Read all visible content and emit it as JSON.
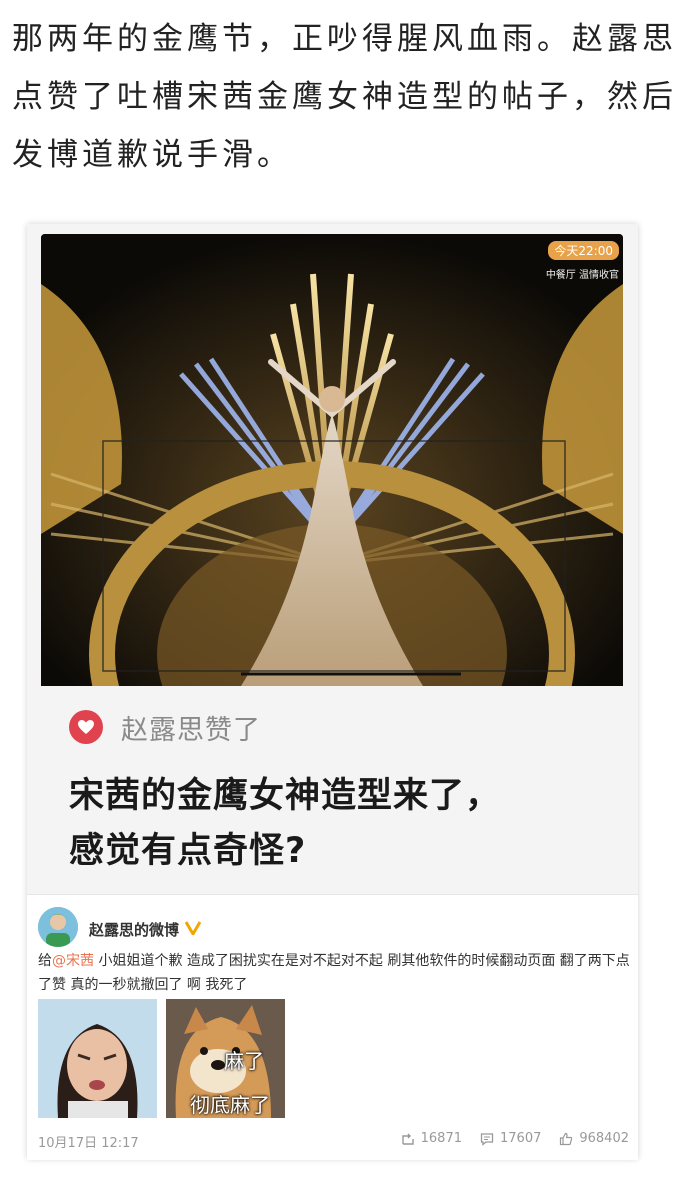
{
  "article": {
    "intro_text": "那两年的金鹰节，正吵得腥风血雨。赵露思点赞了吐槽宋茜金鹰女神造型的帖子，然后发博道歉说手滑。"
  },
  "screenshot_card": {
    "broadcast": {
      "time_badge": "今天22:00",
      "channel_label": "中餐厅 温情收官"
    },
    "liked_by": "赵露思赞了",
    "post_title_line1": "宋茜的金鹰女神造型来了，",
    "post_title_line2": "感觉有点奇怪?",
    "colors": {
      "heart": "#e0434e",
      "mention": "#eb7350"
    }
  },
  "weibo_post": {
    "username": "赵露思的微博",
    "text_before_mention": "给",
    "mention": "@宋茜",
    "text_after_mention": " 小姐姐道个歉 造成了困扰实在是对不起对不起 刷其他软件的时候翻动页面 翻了两下点了赞 真的一秒就撤回了 啊 我死了",
    "meme_caption_top": "麻了",
    "meme_caption_bottom": "彻底麻了",
    "date": "10月17日 12:17",
    "reposts": "16871",
    "comments": "17607",
    "likes": "968402"
  }
}
